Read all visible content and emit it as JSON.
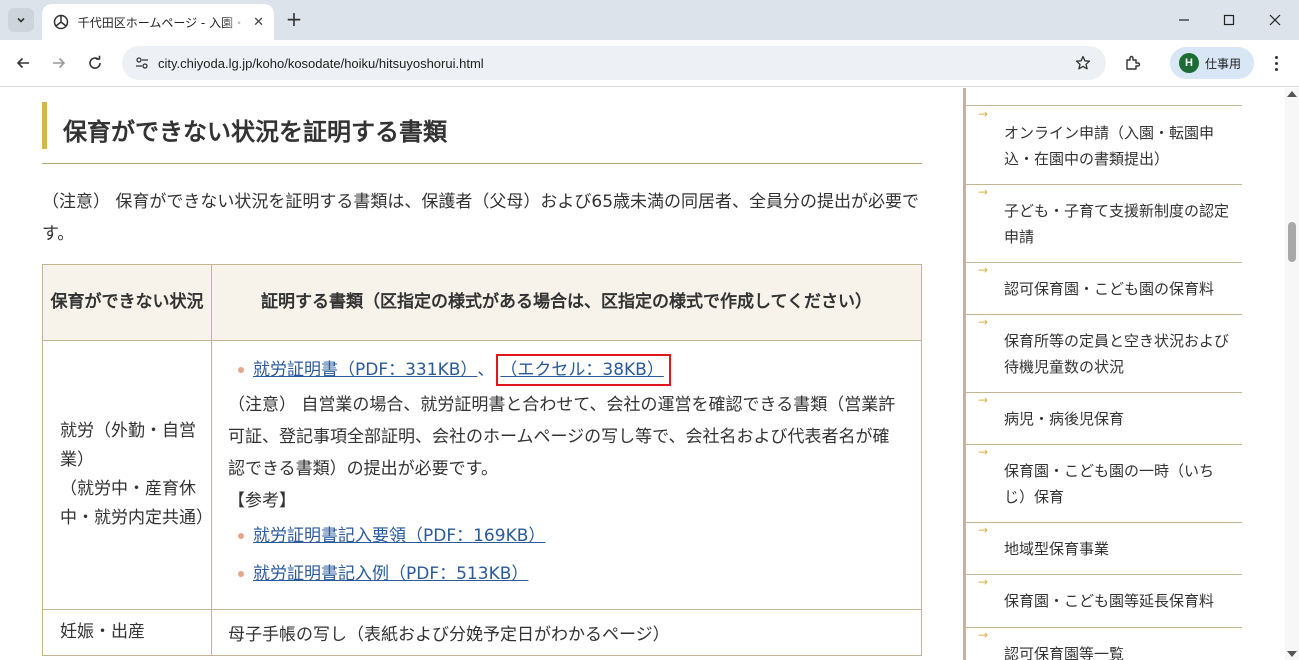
{
  "browser": {
    "tab_title": "千代田区ホームページ - 入園・転園",
    "url": "city.chiyoda.lg.jp/koho/kosodate/hoiku/hitsuyoshorui.html",
    "profile_initial": "H",
    "profile_name": "仕事用"
  },
  "main": {
    "heading": "保育ができない状況を証明する書類",
    "note": "（注意） 保育ができない状況を証明する書類は、保護者（父母）および65歳未満の同居者、全員分の提出が必要です。",
    "table": {
      "headers": [
        "保育ができない状況",
        "証明する書類（区指定の様式がある場合は、区指定の様式で作成してください）"
      ],
      "row_employment": {
        "situation_lines": [
          "就労（外勤・自営業）",
          "（就労中・産育休中・就労内定共通）"
        ],
        "link_pdf": "就労証明書（PDF：331KB）",
        "separator": "、",
        "link_excel": "（エクセル：38KB）",
        "note": "（注意） 自営業の場合、就労証明書と合わせて、会社の運営を確認できる書類（営業許可証、登記事項全部証明、会社のホームページの写し等で、会社名および代表者名が確認できる書類）の提出が必要です。",
        "reference_label": "【参考】",
        "reference_links": [
          "就労証明書記入要領（PDF：169KB）",
          "就労証明書記入例（PDF：513KB）"
        ]
      },
      "row_pregnancy": {
        "situation": "妊娠・出産",
        "document": "母子手帳の写し（表紙および分娩予定日がわかるページ）"
      }
    }
  },
  "sidebar": {
    "items": [
      "オンライン申請（入園・転園申込・在園中の書類提出）",
      "子ども・子育て支援新制度の認定申請",
      "認可保育園・こども園の保育料",
      "保育所等の定員と空き状況および待機児童数の状況",
      "病児・病後児保育",
      "保育園・こども園の一時（いちじ）保育",
      "地域型保育事業",
      "保育園・こども園等延長保育料",
      "認可保育園等一覧"
    ],
    "arrow_glyph": "→"
  },
  "colors": {
    "accent_gold": "#d9b44a",
    "border_tan": "#c4b48f",
    "link_blue": "#2a5a9c",
    "highlight_red": "#e4161c"
  }
}
